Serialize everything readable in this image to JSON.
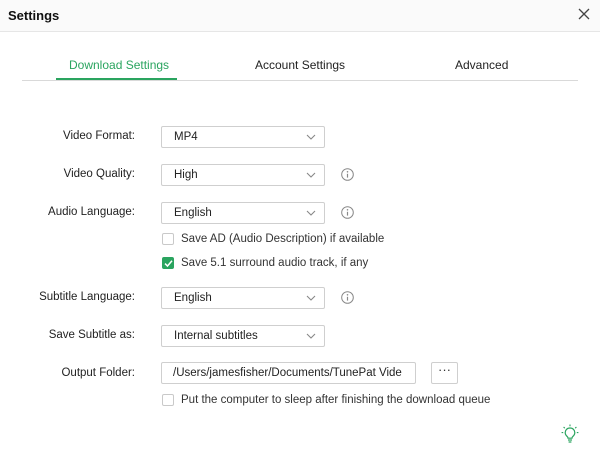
{
  "window": {
    "title": "Settings"
  },
  "tabs": [
    {
      "label": "Download Settings",
      "active": true
    },
    {
      "label": "Account Settings",
      "active": false
    },
    {
      "label": "Advanced",
      "active": false
    }
  ],
  "form": {
    "video_format": {
      "label": "Video Format:",
      "value": "MP4"
    },
    "video_quality": {
      "label": "Video Quality:",
      "value": "High"
    },
    "audio_language": {
      "label": "Audio Language:",
      "value": "English"
    },
    "save_ad": {
      "label": "Save AD (Audio Description) if available",
      "checked": false
    },
    "save_surround": {
      "label": "Save 5.1 surround audio track, if any",
      "checked": true
    },
    "subtitle_language": {
      "label": "Subtitle Language:",
      "value": "English"
    },
    "save_subtitle_as": {
      "label": "Save Subtitle as:",
      "value": "Internal subtitles"
    },
    "output_folder": {
      "label": "Output Folder:",
      "value": "/Users/jamesfisher/Documents/TunePat Vide",
      "browse_label": "···"
    },
    "sleep_after": {
      "label": "Put the computer to sleep after finishing the download queue",
      "checked": false
    }
  },
  "colors": {
    "accent": "#2aa45f",
    "border": "#cfcfcf",
    "text": "#222222"
  },
  "icons": [
    "close-icon",
    "chevron-down-icon",
    "info-icon",
    "checkmark-icon",
    "lightbulb-icon"
  ]
}
